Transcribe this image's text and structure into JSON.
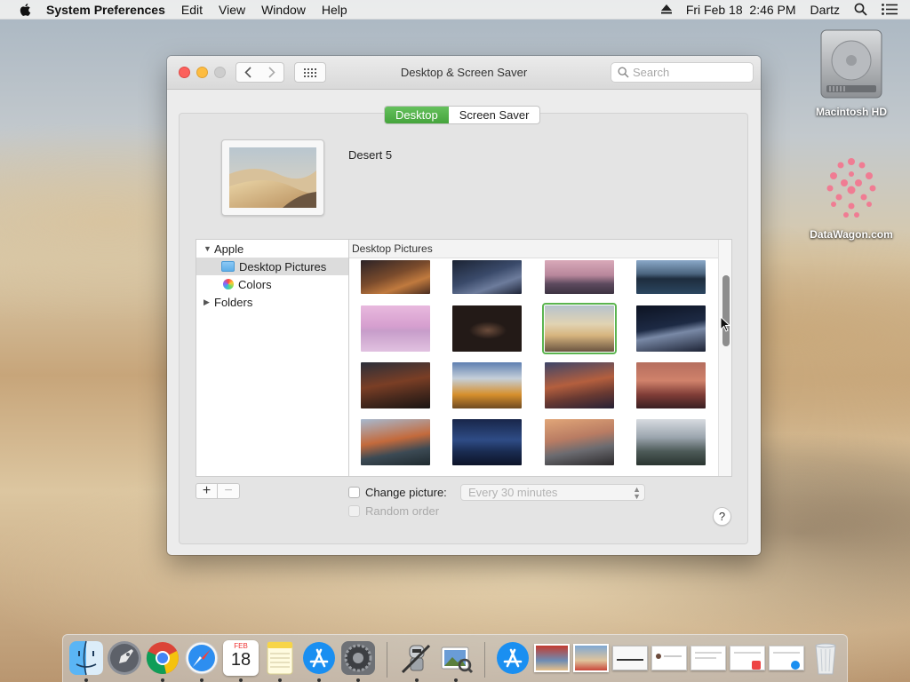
{
  "menubar": {
    "app_name": "System Preferences",
    "menus": [
      "Edit",
      "View",
      "Window",
      "Help"
    ],
    "datetime": "Fri Feb 18  2:46 PM",
    "user": "Dartz"
  },
  "desktop_icons": [
    {
      "label": "Macintosh HD",
      "icon": "hard-drive-icon"
    },
    {
      "label": "DataWagon.com",
      "icon": "datawagon-icon"
    }
  ],
  "window": {
    "title": "Desktop & Screen Saver",
    "search_placeholder": "Search",
    "tabs": [
      {
        "label": "Desktop",
        "active": true
      },
      {
        "label": "Screen Saver",
        "active": false
      }
    ],
    "current_picture_name": "Desert 5",
    "source_list": [
      {
        "label": "Apple",
        "level": 0,
        "expanded": true,
        "icon": "disclosure-triangle-down"
      },
      {
        "label": "Desktop Pictures",
        "level": 1,
        "selected": true,
        "icon": "folder-icon"
      },
      {
        "label": "Colors",
        "level": 1,
        "selected": false,
        "icon": "color-wheel-icon"
      },
      {
        "label": "Folders",
        "level": 0,
        "expanded": false,
        "icon": "disclosure-triangle-right"
      }
    ],
    "grid_header": "Desktop Pictures",
    "thumbnails": [
      {
        "name": "mojave-dunes-night",
        "selected": false
      },
      {
        "name": "mojave-dunes-blue",
        "selected": false
      },
      {
        "name": "rock-pink-dusk",
        "selected": false
      },
      {
        "name": "lake-sunset",
        "selected": false
      },
      {
        "name": "pink-island",
        "selected": false
      },
      {
        "name": "dark-rocks",
        "selected": false
      },
      {
        "name": "desert-5",
        "selected": true
      },
      {
        "name": "night-dune",
        "selected": false
      },
      {
        "name": "dark-mountain-sunset",
        "selected": false
      },
      {
        "name": "high-sierra-autumn",
        "selected": false
      },
      {
        "name": "sierra-dusk-peaks",
        "selected": false
      },
      {
        "name": "sierra-red-peaks",
        "selected": false
      },
      {
        "name": "el-capitan",
        "selected": false
      },
      {
        "name": "yosemite-night",
        "selected": false
      },
      {
        "name": "half-dome-sunset",
        "selected": false
      },
      {
        "name": "yosemite-snow",
        "selected": false
      }
    ],
    "change_picture_label": "Change picture:",
    "change_picture_checked": false,
    "interval_value": "Every 30 minutes",
    "random_order_label": "Random order",
    "random_order_checked": false,
    "help": "?"
  },
  "dock": {
    "apps": [
      {
        "name": "Finder",
        "icon": "finder-icon",
        "running": true
      },
      {
        "name": "Launchpad",
        "icon": "launchpad-icon",
        "running": false
      },
      {
        "name": "Google Chrome",
        "icon": "chrome-icon",
        "running": true
      },
      {
        "name": "Safari",
        "icon": "safari-icon",
        "running": true
      },
      {
        "name": "Calendar",
        "icon": "calendar-icon",
        "running": true,
        "month": "FEB",
        "day": "18"
      },
      {
        "name": "Notes",
        "icon": "notes-icon",
        "running": true
      },
      {
        "name": "App Store",
        "icon": "app-store-icon",
        "running": true
      },
      {
        "name": "System Preferences",
        "icon": "system-preferences-icon",
        "running": true
      },
      {
        "name": "Automator",
        "icon": "automator-icon",
        "running": true
      },
      {
        "name": "Preview",
        "icon": "preview-icon",
        "running": true
      }
    ],
    "stack_items": [
      {
        "name": "Applications",
        "icon": "app-store-icon"
      },
      {
        "name": "Photo 1",
        "icon": "photo-thumbnail-icon"
      },
      {
        "name": "Photo 2",
        "icon": "photo-thumbnail-icon"
      },
      {
        "name": "Chrome Window",
        "icon": "window-thumbnail-icon"
      },
      {
        "name": "Document 1",
        "icon": "document-thumbnail-icon"
      },
      {
        "name": "Document 2",
        "icon": "document-thumbnail-icon"
      },
      {
        "name": "Document 3",
        "icon": "document-thumbnail-icon"
      },
      {
        "name": "Document 4",
        "icon": "document-thumbnail-icon"
      },
      {
        "name": "Trash",
        "icon": "trash-icon"
      }
    ]
  },
  "colors": {
    "accent_green": "#4cab43",
    "close": "#fc605c",
    "minimize": "#fdbc40"
  }
}
